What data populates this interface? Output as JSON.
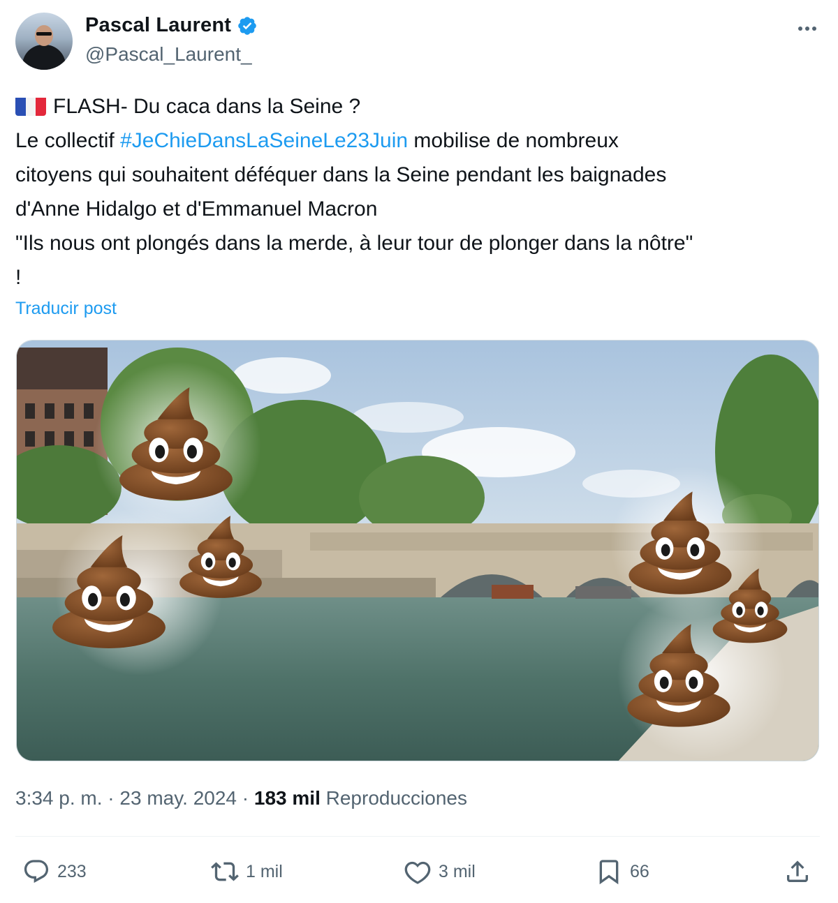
{
  "author": {
    "display_name": "Pascal Laurent",
    "handle": "@Pascal_Laurent_",
    "verified": true
  },
  "tweet": {
    "lines": [
      {
        "flag": "france-flag-icon",
        "text": "FLASH- Du caca dans la Seine ?"
      },
      {
        "prefix": "Le collectif ",
        "hashtag": "#JeChieDansLaSeineLe23Juin",
        "suffix": " mobilise de nombreux"
      },
      {
        "text": "citoyens qui souhaitent déféquer dans la Seine pendant les baignades"
      },
      {
        "text": "d'Anne Hidalgo et d'Emmanuel Macron"
      },
      {
        "text": "\"Ils nous ont plongés dans la merde, à leur tour de plonger dans la nôtre\""
      },
      {
        "text": "!"
      }
    ],
    "translate_label": "Traducir post"
  },
  "meta": {
    "time": "3:34 p. m.",
    "separator": "·",
    "date": "23 may. 2024",
    "views_count": "183 mil",
    "views_label": "Reproducciones"
  },
  "actions": {
    "replies": "233",
    "reposts": "1 mil",
    "likes": "3 mil",
    "bookmarks": "66"
  },
  "colors": {
    "link": "#1d9bf0",
    "muted": "#536471",
    "text": "#0f1419"
  }
}
